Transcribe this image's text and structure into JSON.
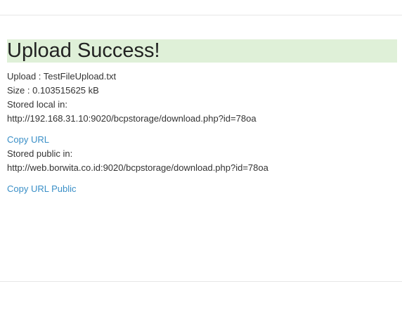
{
  "page": {
    "title": "Upload Success!"
  },
  "upload": {
    "label": "Upload : ",
    "filename": "TestFileUpload.txt",
    "size_label": "Size : ",
    "size_value": "0.103515625 kB",
    "stored_local_label": "Stored local in:",
    "stored_local_url": "http://192.168.31.10:9020/bcpstorage/download.php?id=78oa",
    "copy_url_label": "Copy URL",
    "stored_public_label": "Stored public in:",
    "stored_public_url": "http://web.borwita.co.id:9020/bcpstorage/download.php?id=78oa",
    "copy_url_public_label": "Copy URL Public"
  },
  "colors": {
    "success_bg": "#dff0d8",
    "link": "#3a8fc7",
    "text": "#333333",
    "rule": "#e7e7e7"
  }
}
